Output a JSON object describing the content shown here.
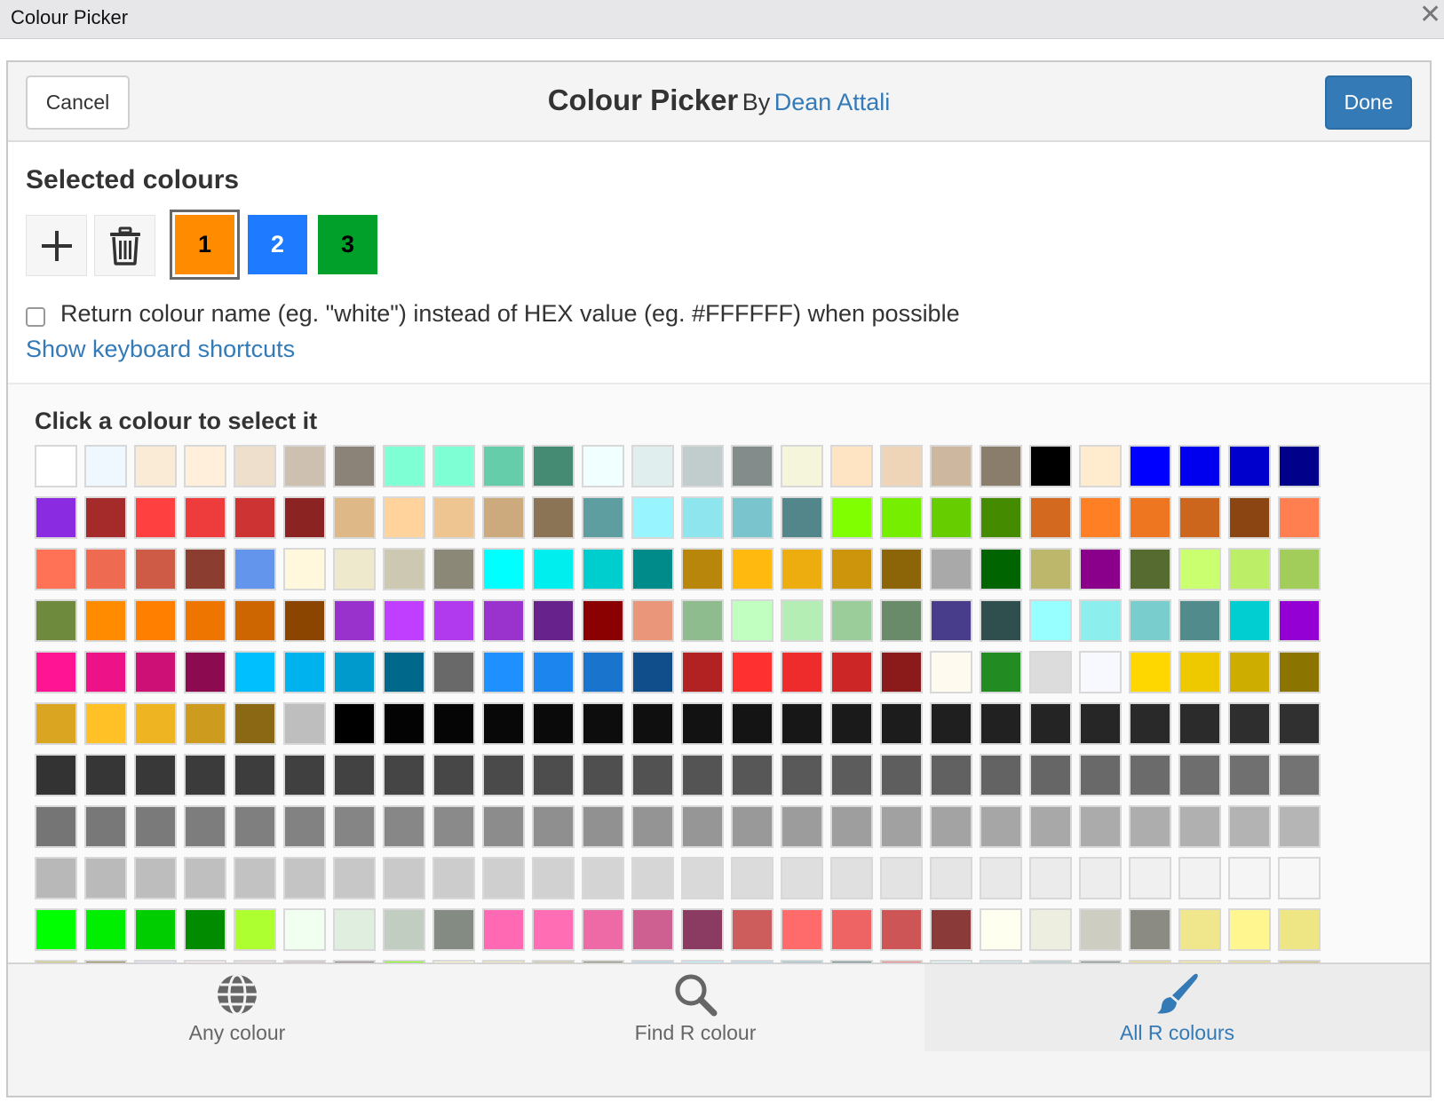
{
  "window": {
    "title": "Colour Picker",
    "close_glyph": "✕"
  },
  "header": {
    "cancel_label": "Cancel",
    "title": "Colour Picker",
    "by_label": "By",
    "author": "Dean Attali",
    "done_label": "Done"
  },
  "selected": {
    "title": "Selected colours",
    "tools": [
      {
        "icon": "plus-icon"
      },
      {
        "icon": "trash-icon"
      }
    ],
    "swatches": [
      {
        "label": "1",
        "color": "#FF8C00",
        "text_color": "#000000",
        "active": true
      },
      {
        "label": "2",
        "color": "#1E7BFF",
        "text_color": "#FFFFFF",
        "active": false
      },
      {
        "label": "3",
        "color": "#00A02A",
        "text_color": "#000000",
        "active": false
      }
    ]
  },
  "options": {
    "return_name_label": "Return colour name (eg. \"white\") instead of HEX value (eg. #FFFFFF) when possible",
    "return_name_checked": false,
    "shortcuts_link": "Show keyboard shortcuts"
  },
  "palette": {
    "title": "Click a colour to select it",
    "rows": [
      [
        "#FFFFFF",
        "#F0F8FF",
        "#FAEBD7",
        "#FFEFDB",
        "#EEDFCC",
        "#CDC0B0",
        "#8B8378",
        "#7FFFD4",
        "#7FFFD4",
        "#66CDAA",
        "#458B74",
        "#F0FFFF",
        "#E0EEEE",
        "#C1CDCD",
        "#838B8B",
        "#F5F5DC",
        "#FFE4C4",
        "#EED5B7",
        "#CDB79E",
        "#8B7D6B",
        "#000000",
        "#FFEBCD",
        "#0000FF",
        "#0000EE",
        "#0000CD",
        "#00008B"
      ],
      [
        "#8A2BE2",
        "#A52A2A",
        "#FF4040",
        "#EE3B3B",
        "#CD3333",
        "#8B2323",
        "#DEB887",
        "#FFD39B",
        "#EEC591",
        "#CDAA7D",
        "#8B7355",
        "#5F9EA0",
        "#98F5FF",
        "#8EE5EE",
        "#7AC5CD",
        "#53868B",
        "#7FFF00",
        "#76EE00",
        "#66CD00",
        "#458B00",
        "#D2691E",
        "#FF7F24",
        "#EE7621",
        "#CD661D",
        "#8B4513",
        "#FF7F50"
      ],
      [
        "#FF7256",
        "#EE6A50",
        "#CD5B45",
        "#8B3E2F",
        "#6495ED",
        "#FFF8DC",
        "#EEE8CD",
        "#CDC8B1",
        "#8B8878",
        "#00FFFF",
        "#00EEEE",
        "#00CDCD",
        "#008B8B",
        "#B8860B",
        "#FFB90F",
        "#EEAD0E",
        "#CD950C",
        "#8B6508",
        "#A9A9A9",
        "#006400",
        "#BDB76B",
        "#8B008B",
        "#556B2F",
        "#CAFF70",
        "#BCEE68",
        "#A2CD5A"
      ],
      [
        "#6E8B3D",
        "#FF8C00",
        "#FF7F00",
        "#EE7600",
        "#CD6600",
        "#8B4500",
        "#9932CC",
        "#BF3EFF",
        "#B23AEE",
        "#9A32CD",
        "#68228B",
        "#8B0000",
        "#E9967A",
        "#8FBC8F",
        "#C1FFC1",
        "#B4EEB4",
        "#9BCD9B",
        "#698B69",
        "#483D8B",
        "#2F4F4F",
        "#97FFFF",
        "#8DEEEE",
        "#79CDCD",
        "#528B8B",
        "#00CED1",
        "#9400D3"
      ],
      [
        "#FF1493",
        "#EE1289",
        "#CD1076",
        "#8B0A50",
        "#00BFFF",
        "#00B2EE",
        "#009ACD",
        "#00688B",
        "#696969",
        "#1E90FF",
        "#1C86EE",
        "#1874CD",
        "#104E8B",
        "#B22222",
        "#FF3030",
        "#EE2C2C",
        "#CD2626",
        "#8B1A1A",
        "#FFFAF0",
        "#228B22",
        "#DCDCDC",
        "#F8F8FF",
        "#FFD700",
        "#EEC900",
        "#CDAD00",
        "#8B7500"
      ],
      [
        "#DAA520",
        "#FFC125",
        "#EEB422",
        "#CD9B1D",
        "#8B6914",
        "#BEBEBE",
        "#000000",
        "#030303",
        "#050505",
        "#080808",
        "#0A0A0A",
        "#0D0D0D",
        "#0F0F0F",
        "#121212",
        "#141414",
        "#171717",
        "#1A1A1A",
        "#1C1C1C",
        "#1F1F1F",
        "#212121",
        "#242424",
        "#262626",
        "#292929",
        "#2B2B2B",
        "#2E2E2E",
        "#303030"
      ],
      [
        "#333333",
        "#363636",
        "#383838",
        "#3B3B3B",
        "#3D3D3D",
        "#404040",
        "#424242",
        "#454545",
        "#474747",
        "#4A4A4A",
        "#4D4D4D",
        "#4F4F4F",
        "#525252",
        "#545454",
        "#575757",
        "#595959",
        "#5C5C5C",
        "#5E5E5E",
        "#616161",
        "#636363",
        "#666666",
        "#696969",
        "#6B6B6B",
        "#6E6E6E",
        "#707070",
        "#737373"
      ],
      [
        "#757575",
        "#787878",
        "#7A7A7A",
        "#7D7D7D",
        "#7F7F7F",
        "#828282",
        "#858585",
        "#878787",
        "#8A8A8A",
        "#8C8C8C",
        "#8F8F8F",
        "#919191",
        "#949494",
        "#969696",
        "#999999",
        "#9C9C9C",
        "#9E9E9E",
        "#A1A1A1",
        "#A3A3A3",
        "#A6A6A6",
        "#A8A8A8",
        "#ABABAB",
        "#ADADAD",
        "#B0B0B0",
        "#B3B3B3",
        "#B5B5B5"
      ],
      [
        "#B8B8B8",
        "#BABABA",
        "#BDBDBD",
        "#BFBFBF",
        "#C2C2C2",
        "#C4C4C4",
        "#C7C7C7",
        "#C9C9C9",
        "#CCCCCC",
        "#CFCFCF",
        "#D1D1D1",
        "#D4D4D4",
        "#D6D6D6",
        "#D9D9D9",
        "#DBDBDB",
        "#DEDEDE",
        "#E0E0E0",
        "#E3E3E3",
        "#E5E5E5",
        "#E8E8E8",
        "#EBEBEB",
        "#EDEDED",
        "#F0F0F0",
        "#F2F2F2",
        "#F5F5F5",
        "#F7F7F7"
      ],
      [
        "#00FF00",
        "#00EE00",
        "#00CD00",
        "#008B00",
        "#ADFF2F",
        "#F0FFF0",
        "#E0EEE0",
        "#C1CDC1",
        "#838B83",
        "#FF69B4",
        "#FF6EB4",
        "#EE6AA7",
        "#CD6090",
        "#8B3A62",
        "#CD5C5C",
        "#FF6A6A",
        "#EE6363",
        "#CD5555",
        "#8B3A3A",
        "#FFFFF0",
        "#EEEEE0",
        "#CDCDC1",
        "#8B8B83",
        "#F0E68C",
        "#FFF68F",
        "#EEE685"
      ],
      [
        "#CDC673",
        "#8B864E",
        "#E6E6FA",
        "#FFF0F5",
        "#EEE0E5",
        "#CDC1C5",
        "#8B8386",
        "#7CFC00",
        "#FFFACD",
        "#EEE9BF",
        "#CDC9A5",
        "#8B8970",
        "#ADD8E6",
        "#BFEFFF",
        "#B2DFEE",
        "#9AC0CD",
        "#68838B",
        "#F08080",
        "#E0FFFF",
        "#D1EEEE",
        "#B4CDCD",
        "#7A8B8B",
        "#EEDD82",
        "#FFEC8B",
        "#EEDC82",
        "#CDBE70"
      ]
    ]
  },
  "tabs": [
    {
      "label": "Any colour",
      "icon": "globe-icon",
      "active": false
    },
    {
      "label": "Find R colour",
      "icon": "search-icon",
      "active": false
    },
    {
      "label": "All R colours",
      "icon": "paintbrush-icon",
      "active": true
    }
  ],
  "colors": {
    "accent": "#337AB7",
    "header_bg": "#F4F4F4",
    "active_outline": "#666666"
  }
}
